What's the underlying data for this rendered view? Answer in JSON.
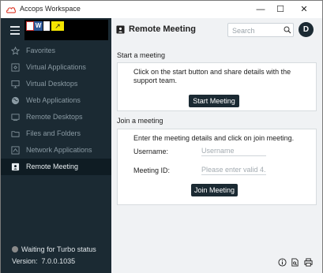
{
  "window": {
    "title": "Accops Workspace",
    "controls": {
      "minimize": "—",
      "maximize": "☐",
      "close": "✕"
    }
  },
  "colors": {
    "sidebar_bg": "#1b2a33",
    "sidebar_active_bg": "#0f1c23",
    "button_bg": "#1b2a33",
    "content_bg": "#f0f2f4",
    "logo_accent": "#e04b3c"
  },
  "sidebar": {
    "items": [
      {
        "label": "Favorites",
        "icon": "star-icon"
      },
      {
        "label": "Virtual Applications",
        "icon": "apps-icon"
      },
      {
        "label": "Virtual Desktops",
        "icon": "monitor-icon"
      },
      {
        "label": "Web Applications",
        "icon": "globe-icon"
      },
      {
        "label": "Remote Desktops",
        "icon": "remote-desktop-icon"
      },
      {
        "label": "Files and Folders",
        "icon": "folder-icon"
      },
      {
        "label": "Network Applications",
        "icon": "network-icon"
      },
      {
        "label": "Remote Meeting",
        "icon": "meeting-icon",
        "active": true
      }
    ],
    "status_text": "Waiting for Turbo status",
    "version_label": "Version:",
    "version_value": "7.0.0.1035"
  },
  "header": {
    "title": "Remote Meeting",
    "search_placeholder": "Search",
    "avatar_initial": "D"
  },
  "start_meeting": {
    "section_title": "Start a meeting",
    "description_line1": "Click on the start button and share details with the",
    "description_line2": "support team.",
    "button_label": "Start Meeting"
  },
  "join_meeting": {
    "section_title": "Join a meeting",
    "description": "Enter the meeting details and click on join meeting.",
    "username_label": "Username:",
    "username_placeholder": "Username",
    "meeting_id_label": "Meeting ID:",
    "meeting_id_placeholder": "Please enter valid 4...",
    "button_label": "Join Meeting"
  },
  "footer_icons": [
    "info-icon",
    "document-search-icon",
    "print-icon"
  ]
}
